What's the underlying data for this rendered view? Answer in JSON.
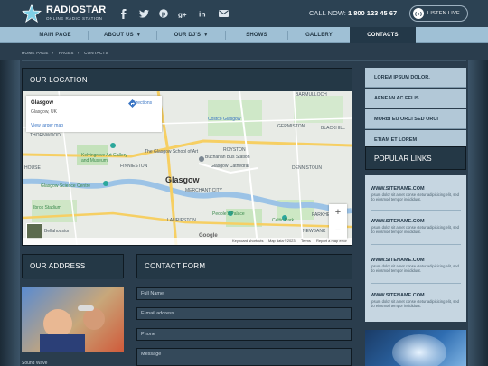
{
  "header": {
    "logo_name": "RADIOSTAR",
    "logo_tagline": "ONLINE RADIO STATION",
    "social_icons": [
      "facebook-icon",
      "twitter-icon",
      "pinterest-icon",
      "google-plus-icon",
      "linkedin-icon",
      "mail-icon"
    ],
    "call_label": "CALL NOW:",
    "phone": "1 800 123 45 67",
    "listen_label": "LISTEN LIVE"
  },
  "nav": {
    "items": [
      {
        "label": "MAIN PAGE"
      },
      {
        "label": "ABOUT US"
      },
      {
        "label": "OUR DJ'S"
      },
      {
        "label": "SHOWS"
      },
      {
        "label": "GALLERY"
      },
      {
        "label": "CONTACTS"
      }
    ],
    "active": "CONTACTS"
  },
  "breadcrumb": [
    "HOME PAGE",
    "PAGES",
    "CONTACTS"
  ],
  "location": {
    "title": "OUR LOCATION",
    "map": {
      "card_title": "Glasgow",
      "card_subtitle": "Glasgow, UK",
      "larger_map": "View larger map",
      "directions": "Directions",
      "city_label": "Glasgow",
      "labels": {
        "barmulloch": "BARMULLOCH",
        "costco": "Costco Glasgow",
        "germiston": "GERMISTON",
        "blackhill": "BLACKHILL",
        "thornwood": "THORNWOOD",
        "royston": "ROYSTON",
        "kelvingrove": "Kelvingrove Art Gallery and Museum",
        "school_of_art": "The Glasgow School of Art",
        "buchanan": "Buchanan Bus Station",
        "finnieston": "FINNIESTON",
        "glasgow_cathedral": "Glasgow Cathedral",
        "house": "HOUSE",
        "dennistoun": "DENNISTOUN",
        "science_centre": "Glasgow Science Centre",
        "merchant_city": "MERCHANT CITY",
        "ibrox": "Ibrox Stadium",
        "peoples_palace": "People's Palace",
        "celtic_park": "Celtic Park",
        "parkhead": "PARKHEAD",
        "laurieston": "LAURIESTON",
        "bellahouston": "Bellahouston",
        "newbank": "NEWBANK"
      },
      "footer": {
        "shortcuts": "Keyboard shortcuts",
        "map_data": "Map data ©2023",
        "terms": "Terms",
        "report": "Report a map error"
      },
      "google": "Google"
    }
  },
  "sidebar": {
    "links": [
      "LOREM IPSUM DOLOR.",
      "AENEAN AC FELIS",
      "MORBI EU ORCI SED ORCI",
      "ETIAM ET LOREM"
    ],
    "popular_title": "POPULAR LINKS",
    "popular": [
      {
        "title": "WWW.SITENAME.COM",
        "desc": "Ipsum dolor sit amet conse ctetur adipisicing elit, sed do eiusmod tempor incididunt."
      },
      {
        "title": "WWW.SITENAME.COM",
        "desc": "Ipsum dolor sit amet conse ctetur adipisicing elit, sed do eiusmod tempor incididunt."
      },
      {
        "title": "WWW.SITENAME.COM",
        "desc": "Ipsum dolor sit amet conse ctetur adipisicing elit, sed do eiusmod tempor incididunt."
      },
      {
        "title": "WWW.SITENAME.COM",
        "desc": "Ipsum dolor sit amet conse ctetur adipisicing elit, sed do eiusmod tempor incididunt."
      }
    ]
  },
  "address": {
    "title": "OUR ADDRESS",
    "caption": "Sound Wave"
  },
  "contact": {
    "title": "CONTACT FORM",
    "fields": {
      "name": "Full Name",
      "email": "E-mail address",
      "phone": "Phone",
      "message": "Message"
    }
  },
  "colors": {
    "page_bg": "#2a3d4d",
    "nav_bg": "#9fc0d5",
    "panel_bg": "#1e2f3c",
    "sidebar_item_bg": "#b2c8d7"
  }
}
